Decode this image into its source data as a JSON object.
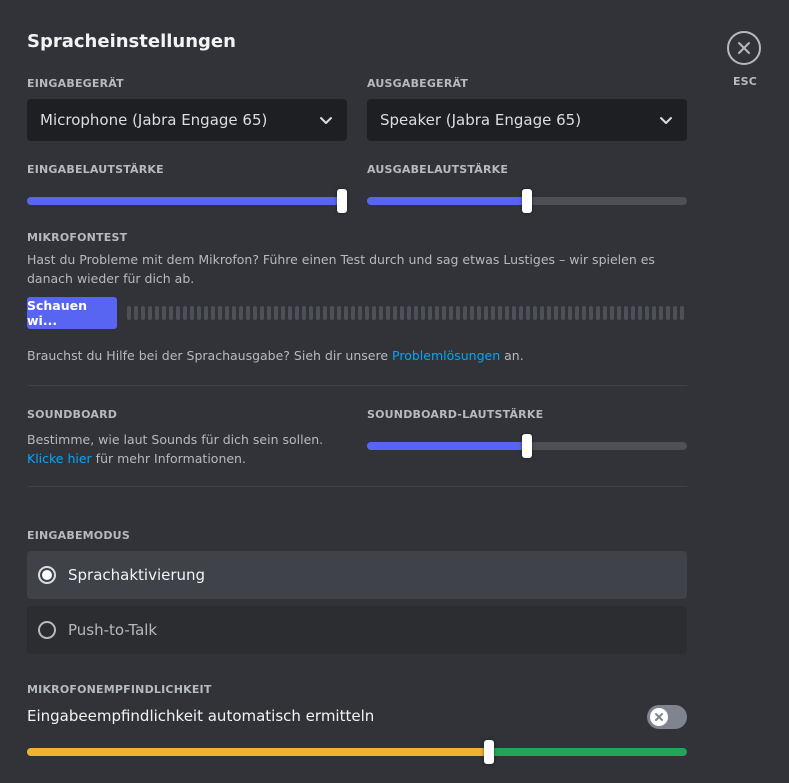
{
  "header": {
    "title": "Spracheinstellungen",
    "close_label": "ESC"
  },
  "devices": {
    "input_label": "EINGABEGERÄT",
    "input_value": "Microphone (Jabra Engage 65)",
    "output_label": "AUSGABEGERÄT",
    "output_value": "Speaker (Jabra Engage 65)"
  },
  "volume": {
    "input_label": "EINGABELAUTSTÄRKE",
    "input_level": 1.0,
    "output_label": "AUSGABELAUTSTÄRKE",
    "output_level": 0.5
  },
  "mic_test": {
    "label": "MIKROFONTEST",
    "description": "Hast du Probleme mit dem Mikrofon? Führe einen Test durch und sag etwas Lustiges – wir spielen es danach wieder für dich ab.",
    "button_label": "Schauen wi...",
    "help_prefix": "Brauchst du Hilfe bei der Sprachausgabe? Sieh dir unsere ",
    "help_link": "Problemlösungen",
    "help_suffix": " an."
  },
  "soundboard": {
    "label": "SOUNDBOARD",
    "desc_prefix": "Bestimme, wie laut Sounds für dich sein sollen. ",
    "desc_link": "Klicke hier",
    "desc_suffix": " für mehr Informationen.",
    "volume_label": "SOUNDBOARD-LAUTSTÄRKE",
    "volume_level": 0.5
  },
  "input_mode": {
    "label": "EINGABEMODUS",
    "options": [
      {
        "label": "Sprachaktivierung",
        "selected": true
      },
      {
        "label": "Push-to-Talk",
        "selected": false
      }
    ]
  },
  "sensitivity": {
    "label": "MIKROFONEMPFINDLICHKEIT",
    "auto_label": "Eingabeempfindlichkeit automatisch ermitteln",
    "auto_enabled": false,
    "threshold_level": 0.7
  },
  "colors": {
    "accent": "#5865f2",
    "link": "#00a8fc",
    "sensitivity_low": "#f0b232",
    "sensitivity_high": "#23a559"
  },
  "icons": {
    "close": "close-icon",
    "chevron": "chevron-down-icon",
    "toggle_off": "x-icon"
  }
}
